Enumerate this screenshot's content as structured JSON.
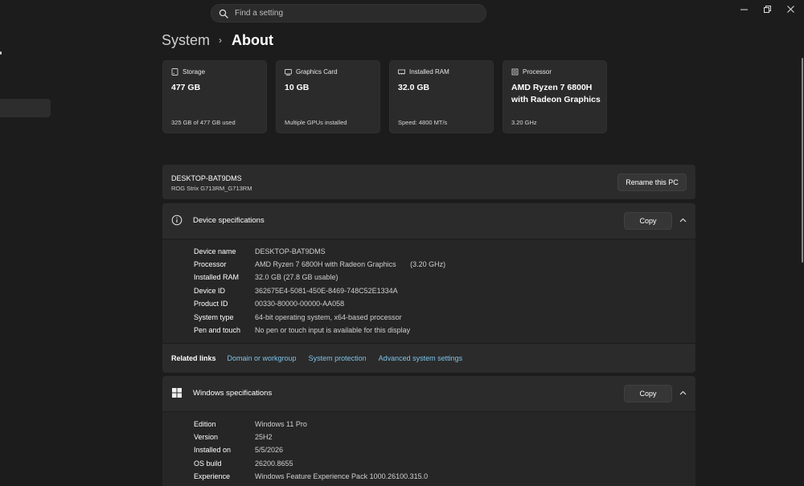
{
  "search": {
    "placeholder": "Find a setting"
  },
  "window": {
    "minimize": "—",
    "restore": "❐",
    "close": "✕"
  },
  "breadcrumb": {
    "parent": "System",
    "separator": "›",
    "current": "About"
  },
  "cards": [
    {
      "icon": "storage-icon",
      "label": "Storage",
      "value": "477 GB",
      "sub": "325 GB of 477 GB used"
    },
    {
      "icon": "graphics-card-icon",
      "label": "Graphics Card",
      "value": "10 GB",
      "sub": "Multiple GPUs installed"
    },
    {
      "icon": "ram-icon",
      "label": "Installed RAM",
      "value": "32.0 GB",
      "sub": "Speed: 4800 MT/s"
    },
    {
      "icon": "processor-icon",
      "label": "Processor",
      "value": "AMD Ryzen 7 6800H with Radeon Graphics",
      "sub": "3.20 GHz"
    }
  ],
  "pc": {
    "name": "DESKTOP-BAT9DMS",
    "model": "ROG Strix G713RM_G713RM",
    "rename_label": "Rename this PC"
  },
  "device_specs": {
    "title": "Device specifications",
    "copy_label": "Copy",
    "rows": [
      {
        "label": "Device name",
        "value": "DESKTOP-BAT9DMS"
      },
      {
        "label": "Processor",
        "value": "AMD Ryzen 7 6800H with Radeon Graphics       (3.20 GHz)"
      },
      {
        "label": "Installed RAM",
        "value": "32.0 GB (27.8 GB usable)"
      },
      {
        "label": "Device ID",
        "value": "362675E4-5081-450E-8469-748C52E1334A"
      },
      {
        "label": "Product ID",
        "value": "00330-80000-00000-AA058"
      },
      {
        "label": "System type",
        "value": "64-bit operating system, x64-based processor"
      },
      {
        "label": "Pen and touch",
        "value": "No pen or touch input is available for this display"
      }
    ]
  },
  "related_links": {
    "title": "Related links",
    "links": [
      "Domain or workgroup",
      "System protection",
      "Advanced system settings"
    ]
  },
  "windows_specs": {
    "title": "Windows specifications",
    "copy_label": "Copy",
    "rows": [
      {
        "label": "Edition",
        "value": "Windows 11 Pro"
      },
      {
        "label": "Version",
        "value": "25H2"
      },
      {
        "label": "Installed on",
        "value": "5/5/2026"
      },
      {
        "label": "OS build",
        "value": "26200.8655"
      },
      {
        "label": "Experience",
        "value": "Windows Feature Experience Pack 1000.26100.315.0"
      }
    ]
  }
}
